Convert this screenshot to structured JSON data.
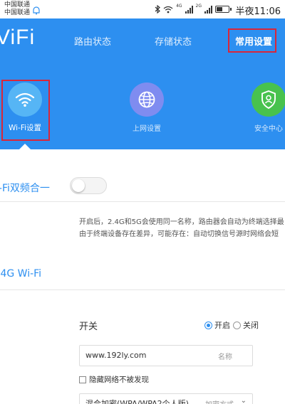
{
  "status_bar": {
    "carrier_1": "中国联通",
    "carrier_2": "中国联通",
    "network_4g": "4G",
    "network_2g": "2G",
    "clock": "半夜11:06",
    "icons": [
      "bluetooth-icon",
      "wifi-signal-icon",
      "cell-signal-icon",
      "battery-icon"
    ]
  },
  "header": {
    "brand": "ViFi",
    "tabs": [
      {
        "label": "路由状态"
      },
      {
        "label": "存储状态"
      },
      {
        "label": "常用设置",
        "active": true
      }
    ],
    "quick_items": [
      {
        "label": "Wi-Fi设置",
        "icon": "wifi-icon",
        "active": true
      },
      {
        "label": "上网设置",
        "icon": "globe-icon"
      },
      {
        "label": "安全中心",
        "icon": "shield-user-icon"
      }
    ]
  },
  "content": {
    "dual_band_label": "i-Fi双频合一",
    "dual_band_on": false,
    "description": [
      "开启后，2.4G和5G会使用同一名称，路由器会自动为终端选择最",
      "由于终端设备存在差异，可能存在：自动切换信号源时网络会短"
    ],
    "section_title": ".4G Wi-Fi",
    "switch_label": "开关",
    "radio_options": [
      {
        "label": "开启",
        "checked": true
      },
      {
        "label": "关闭",
        "checked": false
      }
    ],
    "ssid_value": "www.192ly.com",
    "ssid_hint": "名称",
    "hide_network_label": "隐藏网络不被发现",
    "encryption_value": "混合加密(WPA/WPA2个人版)",
    "encryption_hint": "加密方式"
  },
  "colors": {
    "brand_blue": "#2d8ff0",
    "highlight_red": "#d9263a",
    "wifi_circle": "#56b5f5",
    "globe_circle": "#7f8cf0",
    "shield_circle": "#48c24e"
  }
}
